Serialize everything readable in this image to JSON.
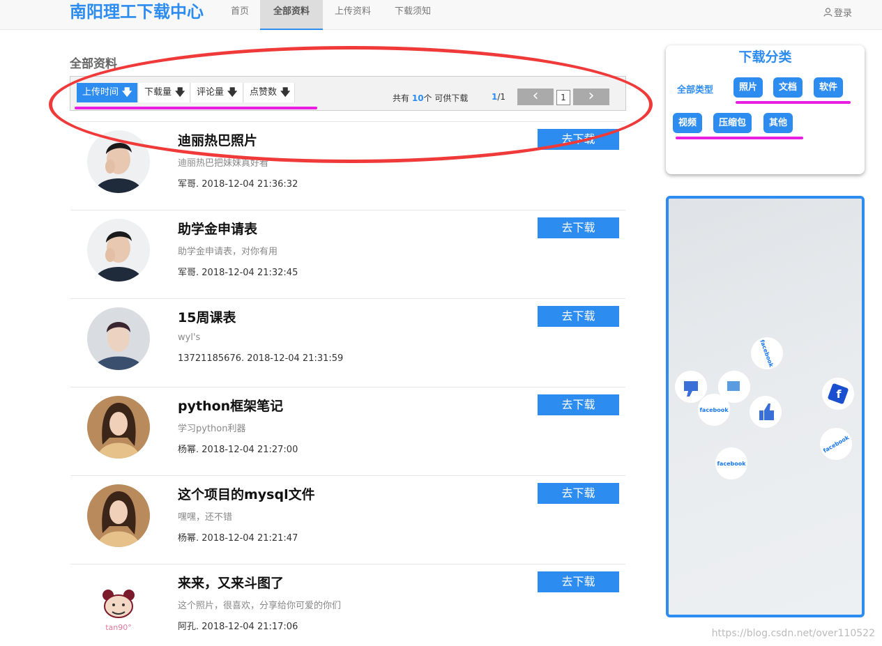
{
  "navbar": {
    "brand": "南阳理工下载中心",
    "items": [
      {
        "label": "首页",
        "active": false
      },
      {
        "label": "全部资料",
        "active": true
      },
      {
        "label": "上传资料",
        "active": false
      },
      {
        "label": "下载须知",
        "active": false
      }
    ],
    "login_label": "登录"
  },
  "main": {
    "section_title": "全部资料",
    "sort_buttons": [
      {
        "label": "上传时间",
        "arrow": "🡇",
        "active": true
      },
      {
        "label": "下载量",
        "arrow": "🡇",
        "active": false
      },
      {
        "label": "评论量",
        "arrow": "🡇",
        "active": false
      },
      {
        "label": "点赞数",
        "arrow": "🡇",
        "active": false
      }
    ],
    "count": {
      "prefix": "共有",
      "number": "10",
      "suffix": "个 可供下载"
    },
    "pagination": {
      "current": "1",
      "total": "/1",
      "page_input": "1",
      "prev": "‹",
      "next": "›"
    },
    "items": [
      {
        "title": "迪丽热巴照片",
        "desc": "迪丽热巴把妹妹真好看",
        "author": "军哥",
        "time": "2018-12-04 21:36:32",
        "button": "去下载",
        "avatar": "man-dark-jacket"
      },
      {
        "title": "助学金申请表",
        "desc": "助学金申请表，对你有用",
        "author": "军哥",
        "time": "2018-12-04 21:32:45",
        "button": "去下载",
        "avatar": "man-dark-jacket"
      },
      {
        "title": "15周课表",
        "desc": "wyl's",
        "author": "13721185676",
        "time": "2018-12-04 21:31:59",
        "button": "去下载",
        "avatar": "young-man-denim"
      },
      {
        "title": "python框架笔记",
        "desc": "学习python利器",
        "author": "杨幂",
        "time": "2018-12-04 21:27:00",
        "button": "去下载",
        "avatar": "woman-long-hair"
      },
      {
        "title": "这个项目的mysql文件",
        "desc": "嘿嘿，还不错",
        "author": "杨幂",
        "time": "2018-12-04 21:21:47",
        "button": "去下载",
        "avatar": "woman-long-hair"
      },
      {
        "title": "来来，又来斗图了",
        "desc": "这个照片，很喜欢，分享给你可爱的你们",
        "author": "阿孔",
        "time": "2018-12-04 21:17:06",
        "button": "去下载",
        "avatar": "panda-meme"
      }
    ]
  },
  "sidebar": {
    "category_title": "下载分类",
    "all_label": "全部类型",
    "chips": [
      "照片",
      "文档",
      "软件",
      "视频",
      "压缩包",
      "其他"
    ]
  },
  "ad": {
    "image": "facebook-buttons-photo",
    "badge_text": "facebook"
  },
  "watermark": "https://blog.csdn.net/over110522",
  "avatar_watermark": "tan90°",
  "colors": {
    "accent": "#2d8cf0",
    "annotation_red": "#f03a3a",
    "annotation_pink": "#e81ee0"
  }
}
